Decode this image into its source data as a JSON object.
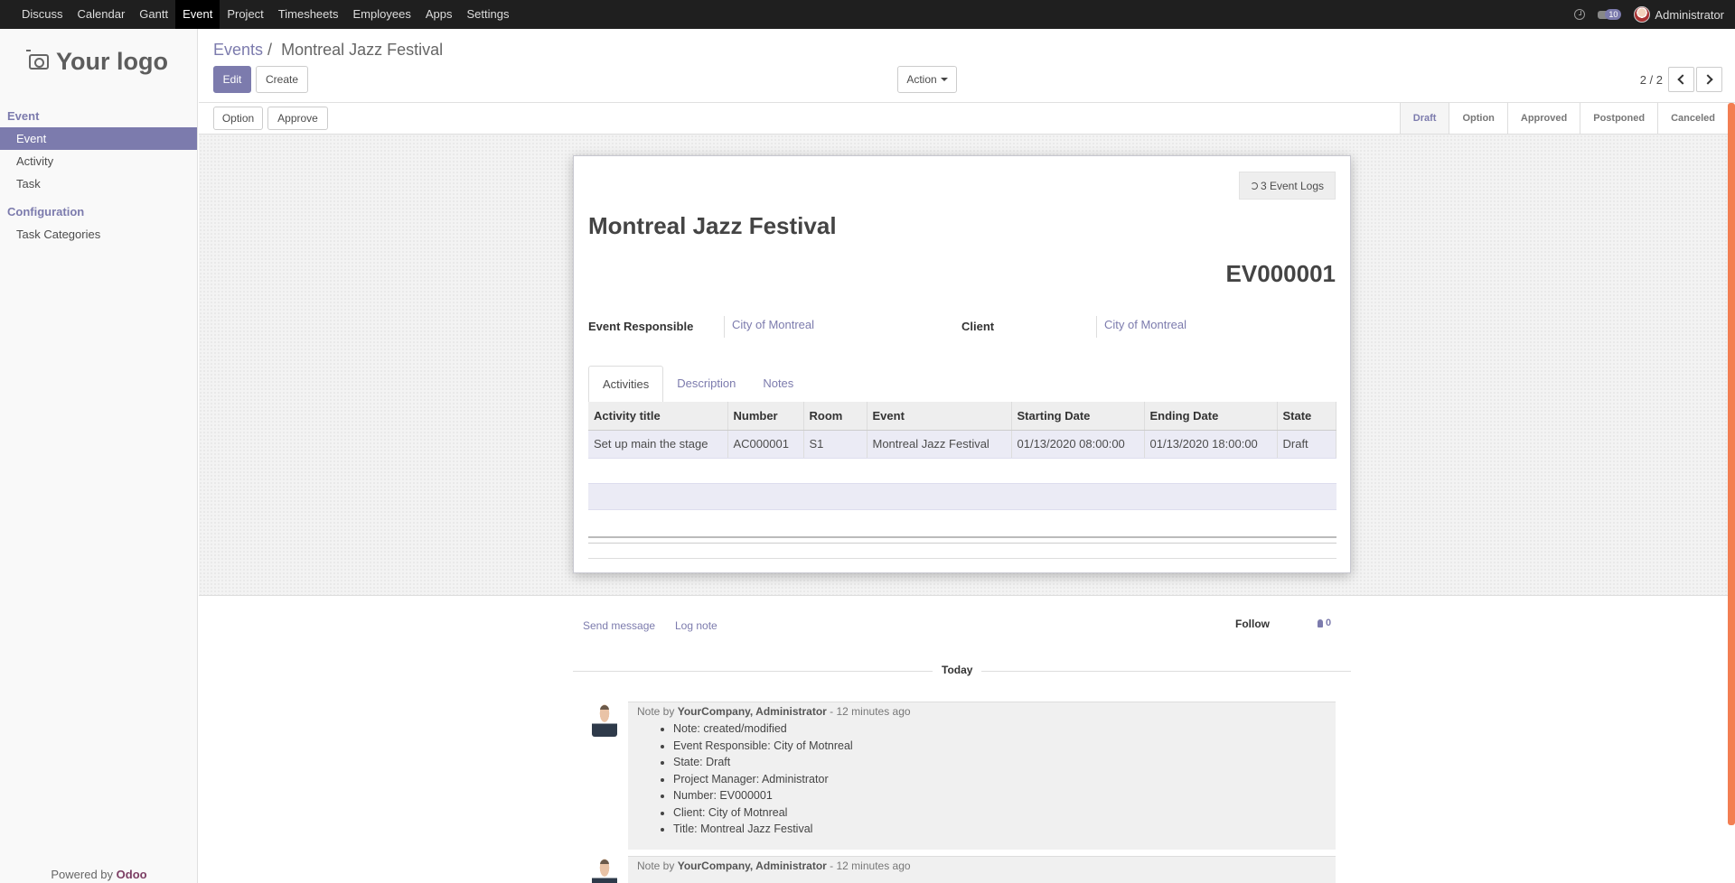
{
  "topmenu": {
    "items": [
      "Discuss",
      "Calendar",
      "Gantt",
      "Event",
      "Project",
      "Timesheets",
      "Employees",
      "Apps",
      "Settings"
    ],
    "active_index": 3,
    "message_count": "10",
    "user_name": "Administrator"
  },
  "sidebar": {
    "logo_text": "Your logo",
    "section_event": "Event",
    "items_event": [
      "Event",
      "Activity",
      "Task"
    ],
    "section_config": "Configuration",
    "items_config": [
      "Task Categories"
    ],
    "powered_prefix": "Powered by",
    "powered_brand": "Odoo"
  },
  "control_panel": {
    "breadcrumb_parent": "Events",
    "breadcrumb_sep": "/",
    "breadcrumb_current": "Montreal Jazz Festival",
    "edit_label": "Edit",
    "create_label": "Create",
    "action_label": "Action",
    "pager_text": "2 / 2"
  },
  "statusbar": {
    "buttons": [
      "Option",
      "Approve"
    ],
    "stages": [
      "Draft",
      "Option",
      "Approved",
      "Postponed",
      "Canceled"
    ],
    "current_stage": "Draft"
  },
  "form": {
    "logs_button": "3 Event Logs",
    "title": "Montreal Jazz Festival",
    "number": "EV000001",
    "responsible_label": "Event Responsible",
    "responsible_value": "City of Montreal",
    "client_label": "Client",
    "client_value": "City of Montreal",
    "tabs": [
      "Activities",
      "Description",
      "Notes"
    ],
    "active_tab": "Activities",
    "table": {
      "headers": [
        "Activity title",
        "Number",
        "Room",
        "Event",
        "Starting Date",
        "Ending Date",
        "State"
      ],
      "rows": [
        [
          "Set up main the stage",
          "AC000001",
          "S1",
          "Montreal Jazz Festival",
          "01/13/2020 08:00:00",
          "01/13/2020 18:00:00",
          "Draft"
        ]
      ]
    }
  },
  "chatter": {
    "send_message": "Send message",
    "log_note": "Log note",
    "follow": "Follow",
    "followers_count": "0",
    "date_separator": "Today",
    "messages": [
      {
        "prefix": "Note by",
        "author": "YourCompany, Administrator",
        "time": "- 12 minutes ago",
        "lines": [
          "Note: created/modified",
          "Event Responsible: City of Motnreal",
          "State: Draft",
          "Project Manager: Administrator",
          "Number: EV000001",
          "Client: City of Motnreal",
          "Title: Montreal Jazz Festival"
        ]
      },
      {
        "prefix": "Note by",
        "author": "YourCompany, Administrator",
        "time": "- 12 minutes ago",
        "lines": []
      }
    ]
  }
}
